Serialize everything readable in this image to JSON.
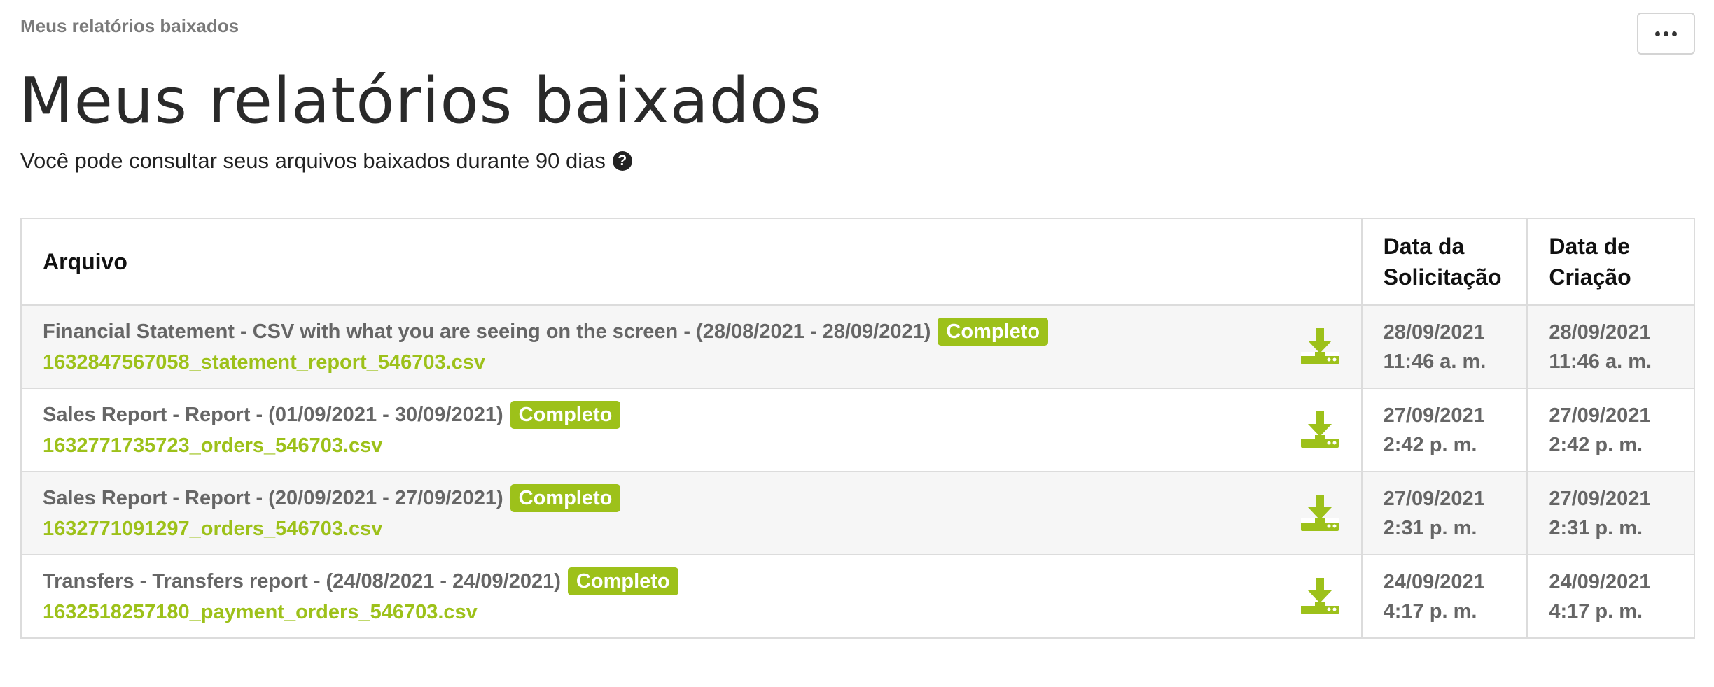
{
  "breadcrumb": "Meus relatórios baixados",
  "title": "Meus relatórios baixados",
  "subtitle": "Você pode consultar seus arquivos baixados durante 90 dias",
  "table": {
    "headers": {
      "file": "Arquivo",
      "request_date_line1": "Data da",
      "request_date_line2": "Solicitação",
      "created_date_line1": "Data de",
      "created_date_line2": "Criação"
    },
    "rows": [
      {
        "title": "Financial Statement - CSV with what you are seeing on the screen - (28/08/2021 - 28/09/2021)",
        "status": "Completo",
        "filename": "1632847567058_statement_report_546703.csv",
        "request_date": "28/09/2021",
        "request_time": "11:46 a. m.",
        "created_date": "28/09/2021",
        "created_time": "11:46 a. m."
      },
      {
        "title": "Sales Report - Report - (01/09/2021 - 30/09/2021)",
        "status": "Completo",
        "filename": "1632771735723_orders_546703.csv",
        "request_date": "27/09/2021",
        "request_time": "2:42 p. m.",
        "created_date": "27/09/2021",
        "created_time": "2:42 p. m."
      },
      {
        "title": "Sales Report - Report - (20/09/2021 - 27/09/2021)",
        "status": "Completo",
        "filename": "1632771091297_orders_546703.csv",
        "request_date": "27/09/2021",
        "request_time": "2:31 p. m.",
        "created_date": "27/09/2021",
        "created_time": "2:31 p. m."
      },
      {
        "title": "Transfers - Transfers report - (24/08/2021 - 24/09/2021)",
        "status": "Completo",
        "filename": "1632518257180_payment_orders_546703.csv",
        "request_date": "24/09/2021",
        "request_time": "4:17 p. m.",
        "created_date": "24/09/2021",
        "created_time": "4:17 p. m."
      }
    ]
  },
  "colors": {
    "accent": "#9dc11a",
    "muted_text": "#666666",
    "border": "#dcdcdc"
  },
  "icons": {
    "more": "more-horizontal-icon",
    "help": "question-circle-icon",
    "download": "download-icon"
  }
}
